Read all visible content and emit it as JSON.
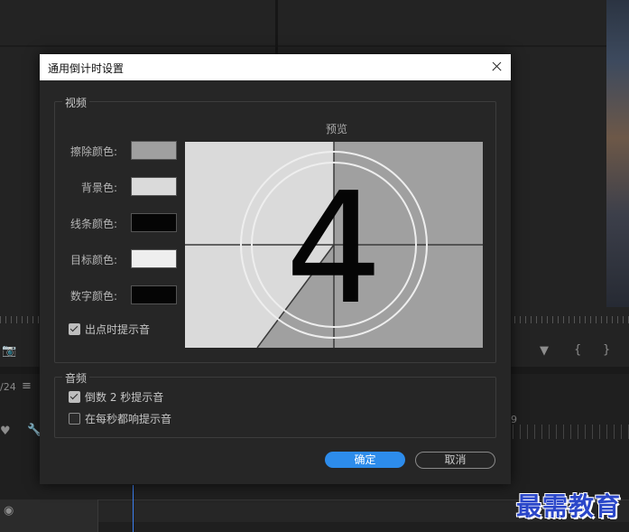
{
  "background": {
    "timecode_fragment": "/24",
    "ruler_number": "9"
  },
  "dialog": {
    "title": "通用倒计时设置",
    "video": {
      "legend": "视频",
      "preview_label": "预览",
      "colors": [
        {
          "label": "擦除颜色:",
          "color": "#a0a0a0"
        },
        {
          "label": "背景色:",
          "color": "#dadada"
        },
        {
          "label": "线条颜色:",
          "color": "#050505"
        },
        {
          "label": "目标颜色:",
          "color": "#eeeeee"
        },
        {
          "label": "数字颜色:",
          "color": "#050505"
        }
      ],
      "cue_on_out": {
        "label": "出点时提示音",
        "checked": true
      },
      "preview_digit": "4"
    },
    "audio": {
      "legend": "音频",
      "cue_2s": {
        "label": "倒数 2 秒提示音",
        "checked": true
      },
      "cue_every_second": {
        "label": "在每秒都响提示音",
        "checked": false
      }
    },
    "buttons": {
      "ok": "确定",
      "cancel": "取消"
    }
  },
  "watermark": "最需教育"
}
